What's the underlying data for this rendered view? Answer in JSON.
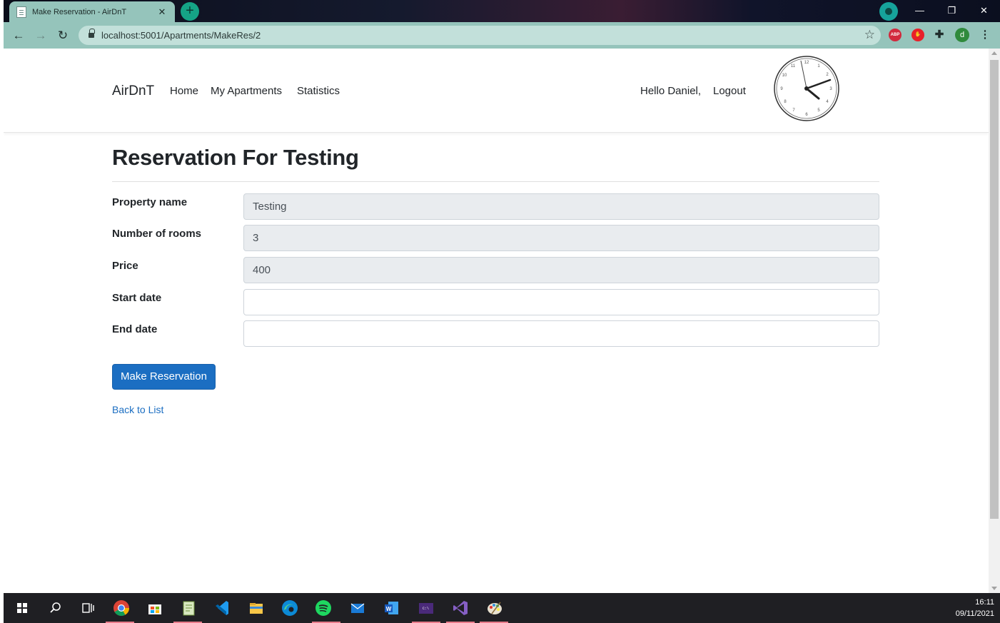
{
  "browser": {
    "tab_title": "Make Reservation - AirDnT",
    "tab_close": "✕",
    "new_tab": "+",
    "window_controls": {
      "minimize": "—",
      "restore": "❐",
      "close": "✕"
    },
    "nav": {
      "back": "←",
      "forward": "→",
      "reload": "↻"
    },
    "url": "localhost:5001/Apartments/MakeRes/2",
    "star": "☆",
    "extensions": {
      "abp": "ABP",
      "stop": "✋",
      "puzzle": "✚",
      "user": "d",
      "menu": "⋮"
    }
  },
  "navbar": {
    "brand": "AirDnT",
    "links": [
      "Home",
      "My Apartments",
      "Statistics"
    ],
    "greeting": "Hello Daniel,",
    "logout": "Logout"
  },
  "clock": {
    "time": "16:11"
  },
  "form": {
    "title": "Reservation For Testing",
    "fields": [
      {
        "label": "Property name",
        "value": "Testing",
        "readonly": true
      },
      {
        "label": "Number of rooms",
        "value": "3",
        "readonly": true
      },
      {
        "label": "Price",
        "value": "400",
        "readonly": true
      },
      {
        "label": "Start date",
        "value": "",
        "readonly": false
      },
      {
        "label": "End date",
        "value": "",
        "readonly": false
      }
    ],
    "submit": "Make Reservation",
    "back_link": "Back to List"
  },
  "taskbar": {
    "apps": [
      "windows-start",
      "search",
      "task-view",
      "chrome",
      "store",
      "notepad-plus",
      "vscode",
      "file-explorer",
      "edge",
      "spotify",
      "mail",
      "word",
      "terminal",
      "visual-studio",
      "paint"
    ],
    "time": "16:11",
    "date": "09/11/2021"
  },
  "colors": {
    "accent": "#1b6ec2",
    "browser_frame": "#95c4bb",
    "readonly_bg": "#e9ecef"
  }
}
